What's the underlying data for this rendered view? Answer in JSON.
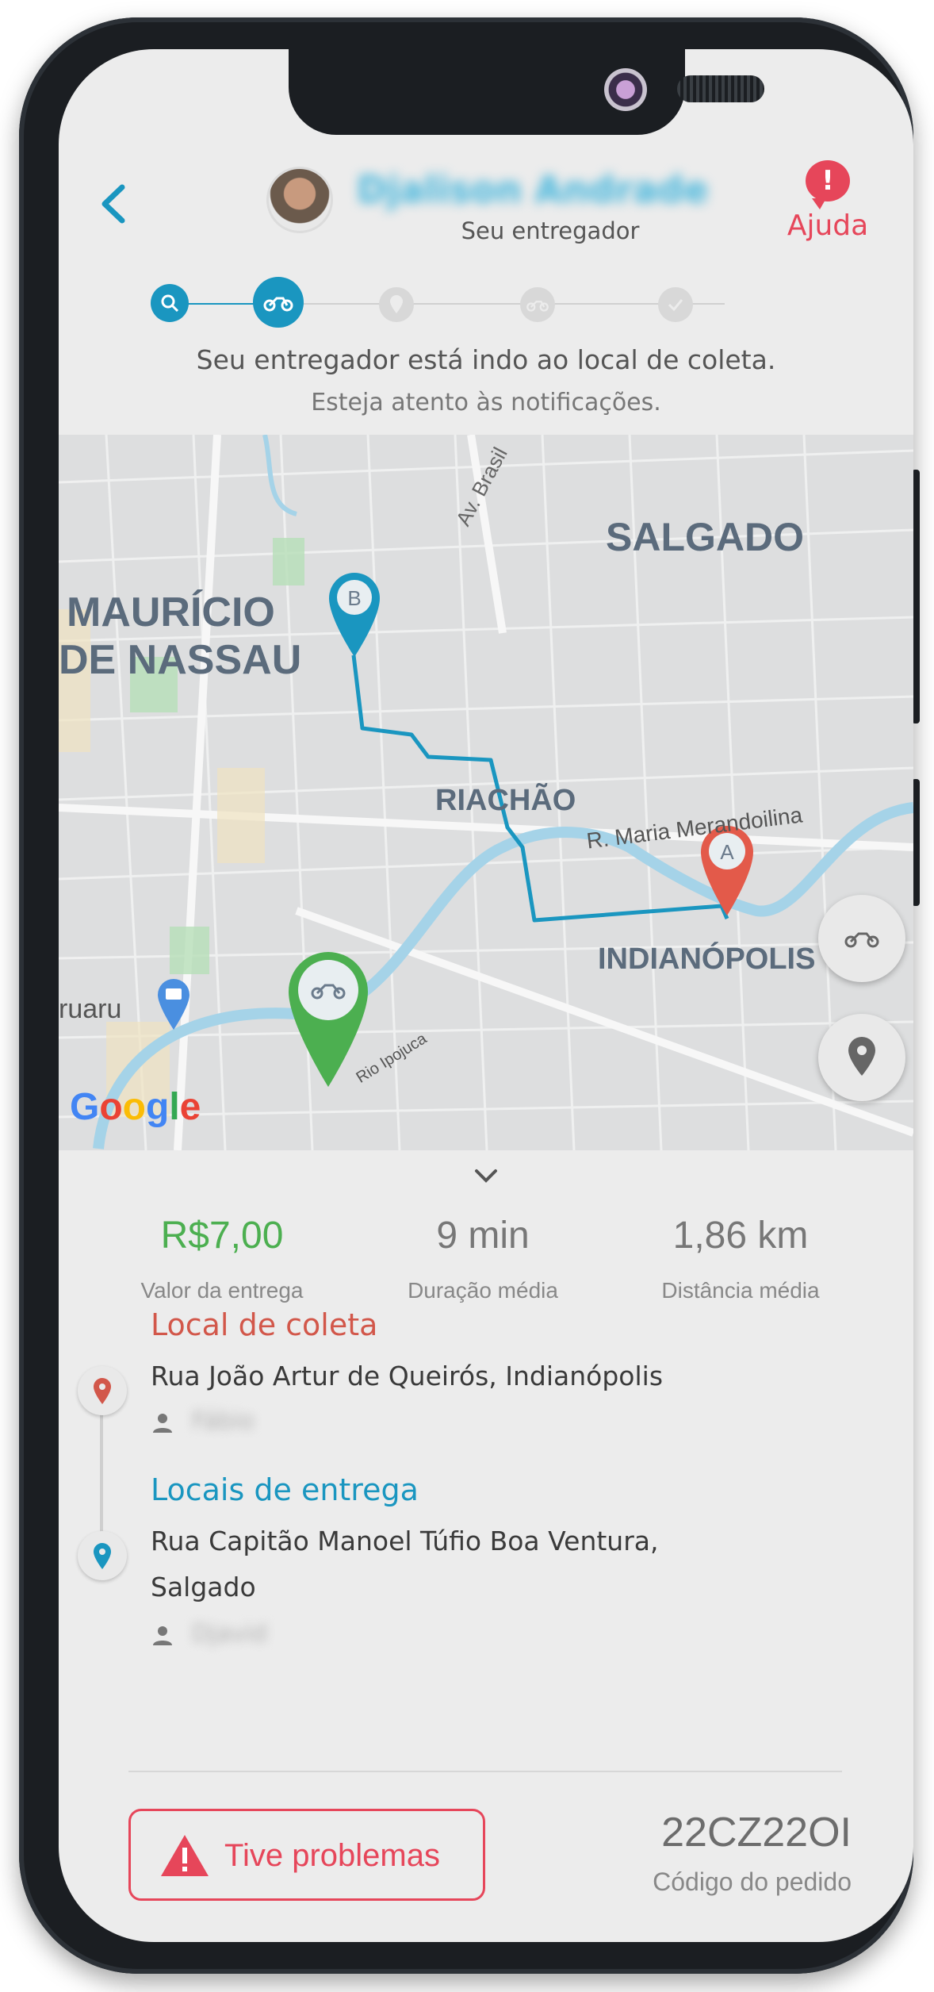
{
  "header": {
    "courier_name": "Djalison Andrade",
    "courier_subtitle": "Seu entregador",
    "help_label": "Ajuda"
  },
  "stepper": {
    "steps": [
      {
        "name": "search-step",
        "state": "done"
      },
      {
        "name": "moto-step",
        "state": "active"
      },
      {
        "name": "pin-step",
        "state": "pending"
      },
      {
        "name": "moto-delivery-step",
        "state": "pending"
      },
      {
        "name": "check-step",
        "state": "pending"
      }
    ]
  },
  "status": {
    "main": "Seu entregador está indo ao local de coleta.",
    "sub": "Esteja atento às notificações."
  },
  "map": {
    "labels": {
      "salgado": "SALGADO",
      "mauricio": "MAURÍCIO",
      "nassau": "DE NASSAU",
      "riachao": "RIACHÃO",
      "indianopolis": "INDIANÓPOLIS",
      "av_brasil": "Av. Brasil",
      "rua_maria": "R. Maria Merandoilina",
      "rio": "Rio Ipojuca",
      "caruaru": "ruaru"
    },
    "marker_a": "A",
    "marker_b": "B",
    "google": [
      "G",
      "o",
      "o",
      "g",
      "l",
      "e"
    ],
    "colors": {
      "route": "#1a96c0",
      "pin_a": "#e35a4a",
      "pin_b": "#1a96c0",
      "pin_courier": "#4caf50",
      "water": "#a5d3e8",
      "park": "#b7dfb8"
    }
  },
  "metrics": [
    {
      "value": "R$7,00",
      "label": "Valor da entrega"
    },
    {
      "value": "9 min",
      "label": "Duração média"
    },
    {
      "value": "1,86 km",
      "label": "Distância média"
    }
  ],
  "pickup": {
    "title": "Local de coleta",
    "address": "Rua João Artur de Queirós, Indianópolis",
    "contact": "Fábio"
  },
  "dropoff": {
    "title": "Locais de entrega",
    "address_line1": "Rua Capitão Manoel Túfio Boa Ventura,",
    "address_line2": "Salgado",
    "contact": "Djavid"
  },
  "footer": {
    "problem_label": "Tive problemas",
    "order_code": "22CZ22OI",
    "order_code_label": "Código do pedido"
  }
}
